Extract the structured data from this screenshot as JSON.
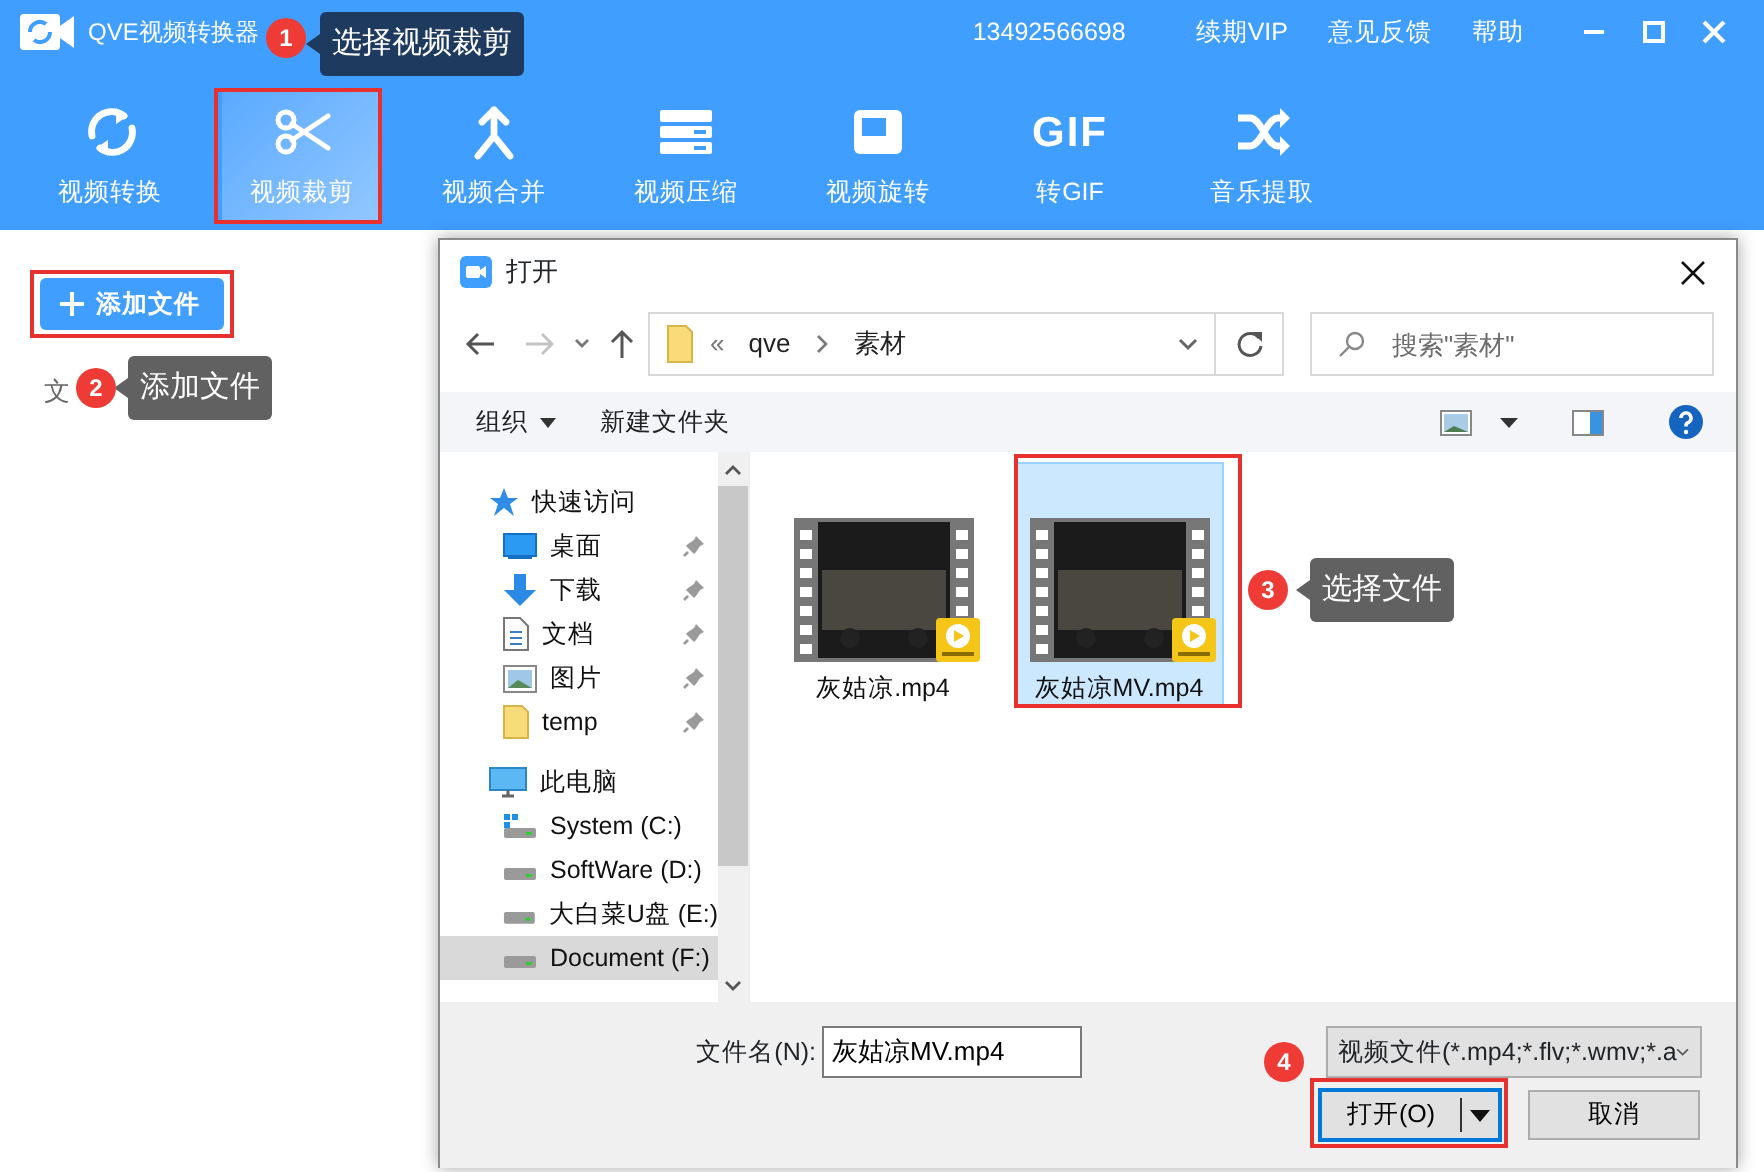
{
  "app": {
    "title": "QVE视频转换器",
    "account": "13492566698",
    "links": [
      "续期VIP",
      "意见反馈",
      "帮助"
    ]
  },
  "toolbar": [
    {
      "label": "视频转换",
      "kind": "convert",
      "selected": false
    },
    {
      "label": "视频裁剪",
      "kind": "scissors",
      "selected": true
    },
    {
      "label": "视频合并",
      "kind": "merge",
      "selected": false
    },
    {
      "label": "视频压缩",
      "kind": "compress",
      "selected": false
    },
    {
      "label": "视频旋转",
      "kind": "rotate",
      "selected": false
    },
    {
      "label": "转GIF",
      "kind": "gif",
      "icon_text": "GIF",
      "selected": false
    },
    {
      "label": "音乐提取",
      "kind": "shuffle",
      "selected": false
    }
  ],
  "left_panel": {
    "add_button": "添加文件",
    "column_label": "文"
  },
  "dialog": {
    "title": "打开",
    "breadcrumb_prefix": "«",
    "breadcrumb": [
      "qve",
      "素材"
    ],
    "search": {
      "placeholder": "搜索\"素材\""
    },
    "commands": [
      {
        "label": "组织",
        "has_menu": true
      },
      {
        "label": "新建文件夹",
        "has_menu": false
      }
    ],
    "nav": [
      {
        "label": "快速访问",
        "kind": "star",
        "selected": false,
        "children": [
          {
            "label": "桌面",
            "kind": "desktop",
            "pinned": true,
            "selected": false
          },
          {
            "label": "下载",
            "kind": "download",
            "pinned": true,
            "selected": false
          },
          {
            "label": "文档",
            "kind": "document",
            "pinned": true,
            "selected": false
          },
          {
            "label": "图片",
            "kind": "pictures",
            "pinned": true,
            "selected": false
          },
          {
            "label": "temp",
            "kind": "folder",
            "pinned": true,
            "selected": false
          }
        ]
      },
      {
        "label": "此电脑",
        "kind": "pc",
        "selected": false,
        "children": [
          {
            "label": "System (C:)",
            "kind": "system-drive",
            "pinned": false,
            "selected": false
          },
          {
            "label": "SoftWare (D:)",
            "kind": "drive",
            "pinned": false,
            "selected": false
          },
          {
            "label": "大白菜U盘 (E:)",
            "kind": "drive",
            "pinned": false,
            "selected": false
          },
          {
            "label": "Document (F:)",
            "kind": "drive",
            "pinned": false,
            "selected": true
          }
        ]
      }
    ],
    "files": [
      {
        "name": "灰姑凉.mp4",
        "selected": false
      },
      {
        "name": "灰姑凉MV.mp4",
        "selected": true
      }
    ],
    "filename_label": "文件名(N):",
    "filename": "灰姑凉MV.mp4",
    "filter": "视频文件(*.mp4;*.flv;*.wmv;*.a",
    "buttons": [
      {
        "label": "打开(O)",
        "kind": "split"
      },
      {
        "label": "取消",
        "kind": "plain"
      }
    ]
  },
  "annotations": [
    {
      "number": "1",
      "tooltip": "选择视频裁剪",
      "color": "#1f3a5f"
    },
    {
      "number": "2",
      "tooltip": "添加文件",
      "color": "#616161"
    },
    {
      "number": "3",
      "tooltip": "选择文件",
      "color": "#616161"
    },
    {
      "number": "4"
    }
  ]
}
